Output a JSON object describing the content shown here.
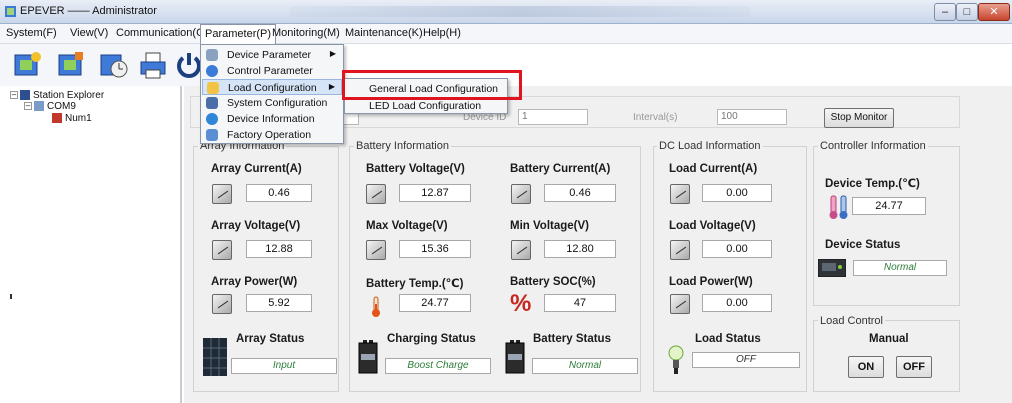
{
  "window": {
    "title": "EPEVER —— Administrator",
    "controls": {
      "minimize": "–",
      "maximize": "□",
      "close": "✕"
    }
  },
  "menubar": {
    "items": [
      "System(F)",
      "View(V)",
      "Communication(C)",
      "Parameter(P)",
      "Monitoring(M)",
      "Maintenance(K)",
      "Help(H)"
    ]
  },
  "toolbar": {
    "icons": [
      "parameter-tool-icon",
      "monitor-tool-icon",
      "clock-tool-icon",
      "printer-icon",
      "power-icon"
    ]
  },
  "explorer": {
    "root": "Station Explorer",
    "port": "COM9",
    "device": "Num1"
  },
  "parameter_menu": {
    "items": [
      {
        "label": "Device Parameter",
        "submenu": true
      },
      {
        "label": "Control Parameter",
        "submenu": false
      },
      {
        "label": "Load Configuration",
        "submenu": true
      },
      {
        "label": "System Configuration",
        "submenu": false
      },
      {
        "label": "Device Information",
        "submenu": false
      },
      {
        "label": "Factory Operation",
        "submenu": false
      }
    ],
    "highlighted": "Load Configuration"
  },
  "load_submenu": {
    "items": [
      "General Load Configuration",
      "LED Load Configuration"
    ],
    "highlighted": "General Load Configuration",
    "highlight_color": "#e0141e"
  },
  "connection": {
    "device_id_label": "Device ID",
    "device_id": "1",
    "interval_label": "Interval(s)",
    "interval": "100",
    "stop_button": "Stop Monitor"
  },
  "array": {
    "title": "Array Information",
    "current_label": "Array Current(A)",
    "current": "0.46",
    "voltage_label": "Array Voltage(V)",
    "voltage": "12.88",
    "power_label": "Array Power(W)",
    "power": "5.92",
    "status_label": "Array Status",
    "status": "Input"
  },
  "battery": {
    "title": "Battery Information",
    "voltage_label": "Battery Voltage(V)",
    "voltage": "12.87",
    "current_label": "Battery Current(A)",
    "current": "0.46",
    "max_voltage_label": "Max Voltage(V)",
    "max_voltage": "15.36",
    "min_voltage_label": "Min Voltage(V)",
    "min_voltage": "12.80",
    "temp_label": "Battery Temp.(℃)",
    "temp": "24.77",
    "soc_label": "Battery SOC(%)",
    "soc": "47",
    "charging_status_label": "Charging Status",
    "charging_status": "Boost Charge",
    "battery_status_label": "Battery Status",
    "battery_status": "Normal"
  },
  "dc_load": {
    "title": "DC Load Information",
    "current_label": "Load Current(A)",
    "current": "0.00",
    "voltage_label": "Load Voltage(V)",
    "voltage": "0.00",
    "power_label": "Load Power(W)",
    "power": "0.00",
    "status_label": "Load Status",
    "status": "OFF"
  },
  "controller": {
    "title": "Controller Information",
    "temp_label": "Device Temp.(℃)",
    "temp": "24.77",
    "status_label": "Device Status",
    "status": "Normal"
  },
  "load_control": {
    "title": "Load Control",
    "mode": "Manual",
    "on_label": "ON",
    "off_label": "OFF"
  },
  "colors": {
    "status_text": "#2e7d3a",
    "menu_highlight": "#d6e4f7",
    "red_box": "#e0141e"
  }
}
